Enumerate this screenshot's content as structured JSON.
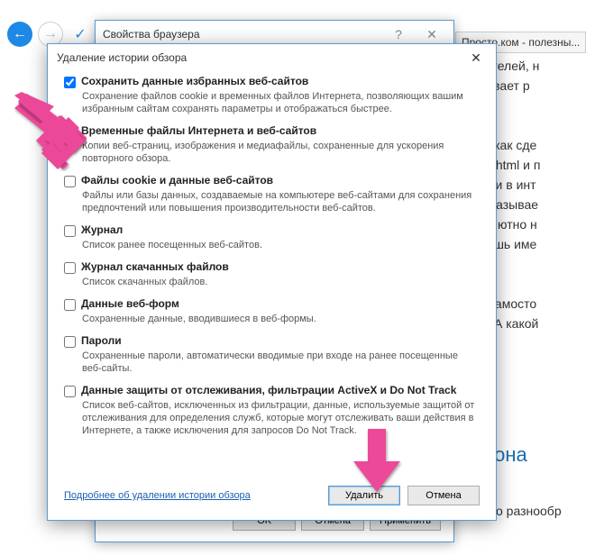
{
  "background": {
    "tab": "Просто.ком - полезны...",
    "lines": [
      "инимателей, н",
      "дстегивает р",
      "о том, как сде",
      "ник по html и п",
      "ранички в инт",
      "ь об оказывае",
      ") абсолютно н",
      "чно лишь име",
      "собы самосто",
      "татье. А какой"
    ],
    "link": "лефона",
    "foot": "–…льно разнообр"
  },
  "parent": {
    "title": "Свойства браузера",
    "buttons": {
      "ok": "OK",
      "cancel": "Отмена",
      "apply": "Применить"
    }
  },
  "dialog": {
    "title": "Удаление истории обзора",
    "moreLink": "Подробнее об удалении истории обзора",
    "buttons": {
      "delete": "Удалить",
      "cancel": "Отмена"
    },
    "options": [
      {
        "id": "fav",
        "checked": true,
        "title": "Сохранить данные избранных веб-сайтов",
        "desc": "Сохранение файлов cookie и временных файлов Интернета, позволяющих вашим избранным сайтам сохранять параметры и отображаться быстрее."
      },
      {
        "id": "temp",
        "checked": true,
        "title": "Временные файлы Интернета и веб-сайтов",
        "desc": "Копии веб-страниц, изображения и медиафайлы, сохраненные для ускорения повторного обзора."
      },
      {
        "id": "cookies",
        "checked": false,
        "title": "Файлы cookie и данные веб-сайтов",
        "desc": "Файлы или базы данных, создаваемые на компьютере веб-сайтами для сохранения предпочтений или повышения производительности веб-сайтов."
      },
      {
        "id": "history",
        "checked": false,
        "title": "Журнал",
        "desc": "Список ранее посещенных веб-сайтов."
      },
      {
        "id": "downloads",
        "checked": false,
        "title": "Журнал скачанных файлов",
        "desc": "Список скачанных файлов."
      },
      {
        "id": "forms",
        "checked": false,
        "title": "Данные веб-форм",
        "desc": "Сохраненные данные, вводившиеся в веб-формы."
      },
      {
        "id": "passwords",
        "checked": false,
        "title": "Пароли",
        "desc": "Сохраненные пароли, автоматически вводимые при входе на ранее посещенные веб-сайты."
      },
      {
        "id": "tracking",
        "checked": false,
        "title": "Данные защиты от отслеживания, фильтрации ActiveX и Do Not Track",
        "desc": "Список веб-сайтов, исключенных из фильтрации, данные, используемые защитой от отслеживания для определения служб, которые могут отслеживать ваши действия в Интернете, а также исключения для запросов Do Not Track."
      }
    ]
  }
}
